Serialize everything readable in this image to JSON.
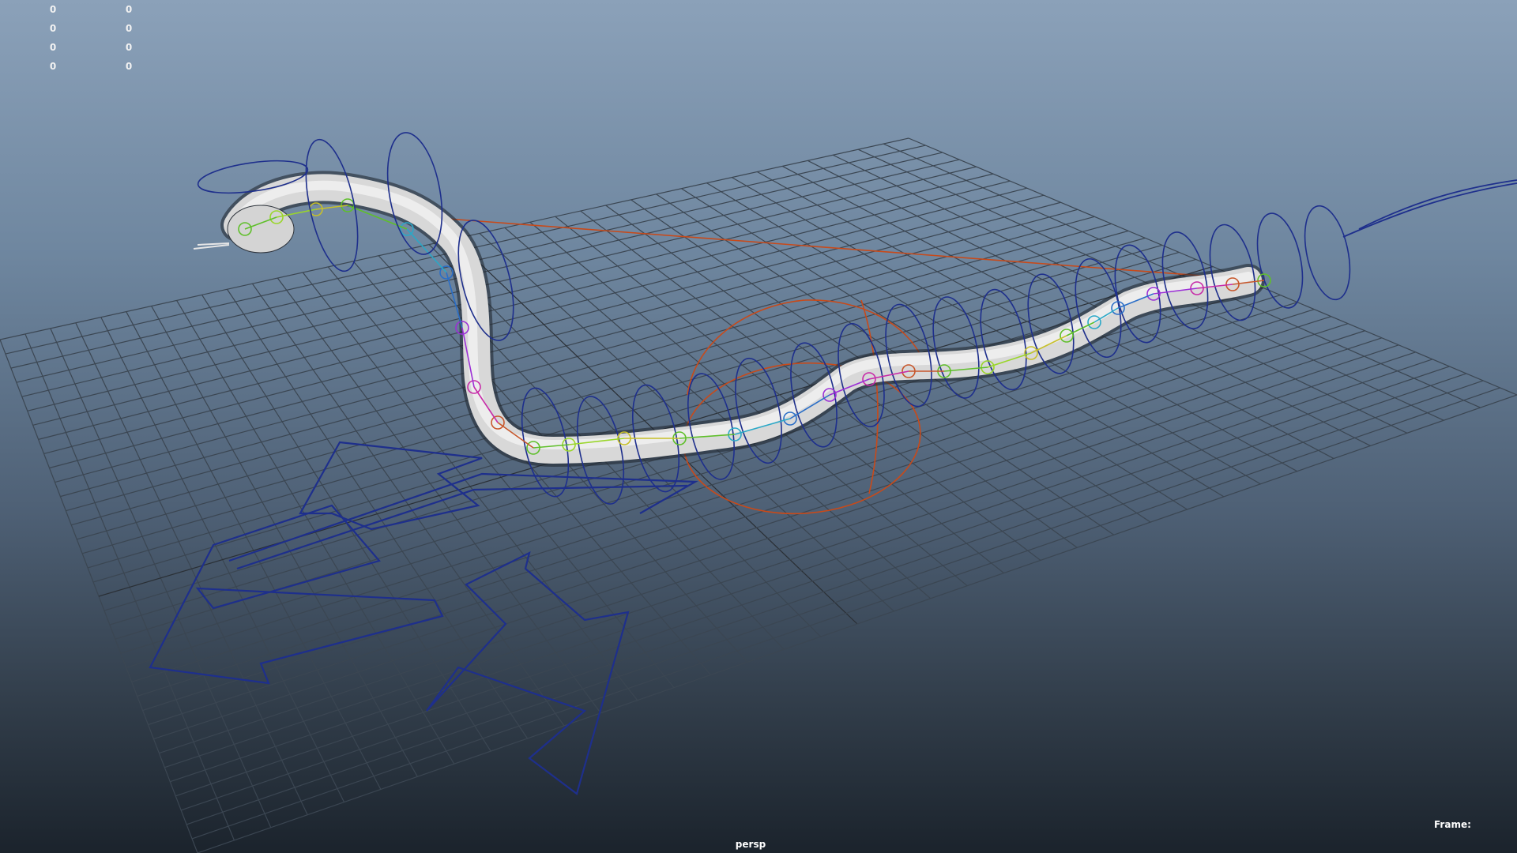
{
  "viewport": {
    "hud": {
      "rows": [
        [
          "0",
          "0"
        ],
        [
          "0",
          "0"
        ],
        [
          "0",
          "0"
        ],
        [
          "0",
          "0"
        ]
      ]
    },
    "camera_label": "persp",
    "frame_label": "Frame:",
    "colors": {
      "grid": "#3b4652",
      "grid_axis": "#2a2f35",
      "snake_body": "#d8d8d8",
      "control_blue": "#1e2f8c",
      "control_orange": "#c84a1a",
      "joint_green": "#5fbf2a",
      "joint_purple": "#9b2fd6"
    }
  }
}
